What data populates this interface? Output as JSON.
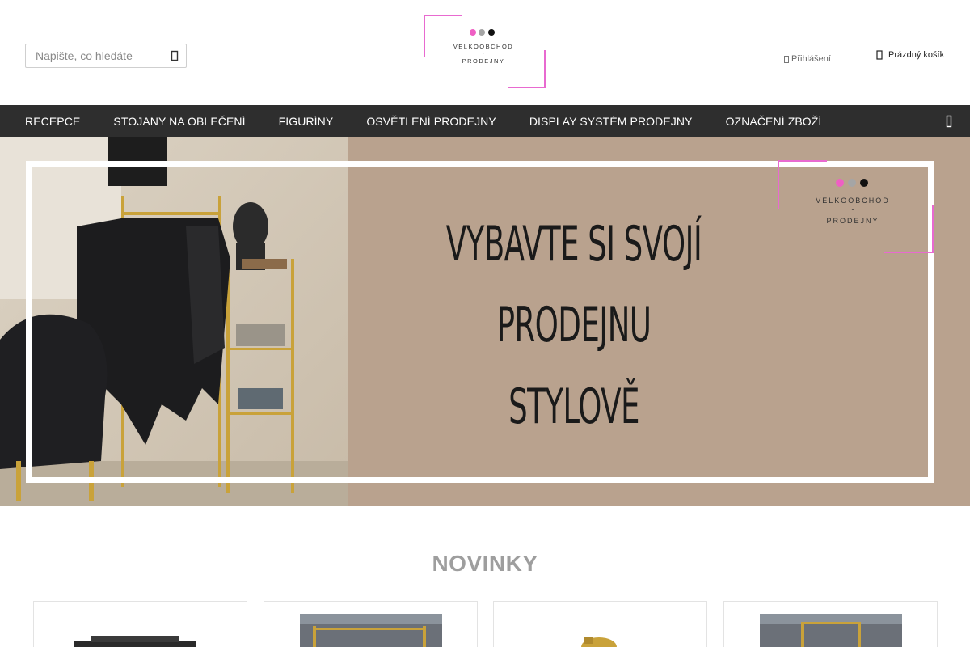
{
  "header": {
    "search": {
      "placeholder": "Napište, co hledáte",
      "value": "",
      "icon": "search-icon"
    },
    "logo": {
      "line1": "VELKOOBCHOD",
      "dash": "-",
      "line2": "PRODEJNY",
      "dot_colors": [
        "#ef5fc4",
        "#a5a5a5",
        "#111111"
      ],
      "accent": "#e86ad0"
    },
    "login": {
      "label": "Přihlášení",
      "icon": "user-icon"
    },
    "cart": {
      "label": "Prázdný košík",
      "icon": "cart-icon"
    }
  },
  "nav": {
    "items": [
      {
        "label": "Recepce"
      },
      {
        "label": "Stojany na oblečení"
      },
      {
        "label": "Figuríny"
      },
      {
        "label": "Osvětlení prodejny"
      },
      {
        "label": "Display systém prodejny"
      },
      {
        "label": "Označení zboží"
      }
    ],
    "more_icon": "more-vertical-icon",
    "background": "#2e2e2e"
  },
  "hero": {
    "line1": "VYBAVTE SI SVOJÍ",
    "line2": "PRODEJNU",
    "line3": "STYLOVĚ",
    "background": "#b9a28e",
    "logo": {
      "line1": "VELKOOBCHOD",
      "dash": "-",
      "line2": "PRODEJNY"
    }
  },
  "section": {
    "title": "NOVINKY"
  },
  "products": [
    {
      "image": "black-table-image"
    },
    {
      "image": "gold-rack-image"
    },
    {
      "image": "gold-mannequin-image"
    },
    {
      "image": "gold-rack-image"
    }
  ]
}
